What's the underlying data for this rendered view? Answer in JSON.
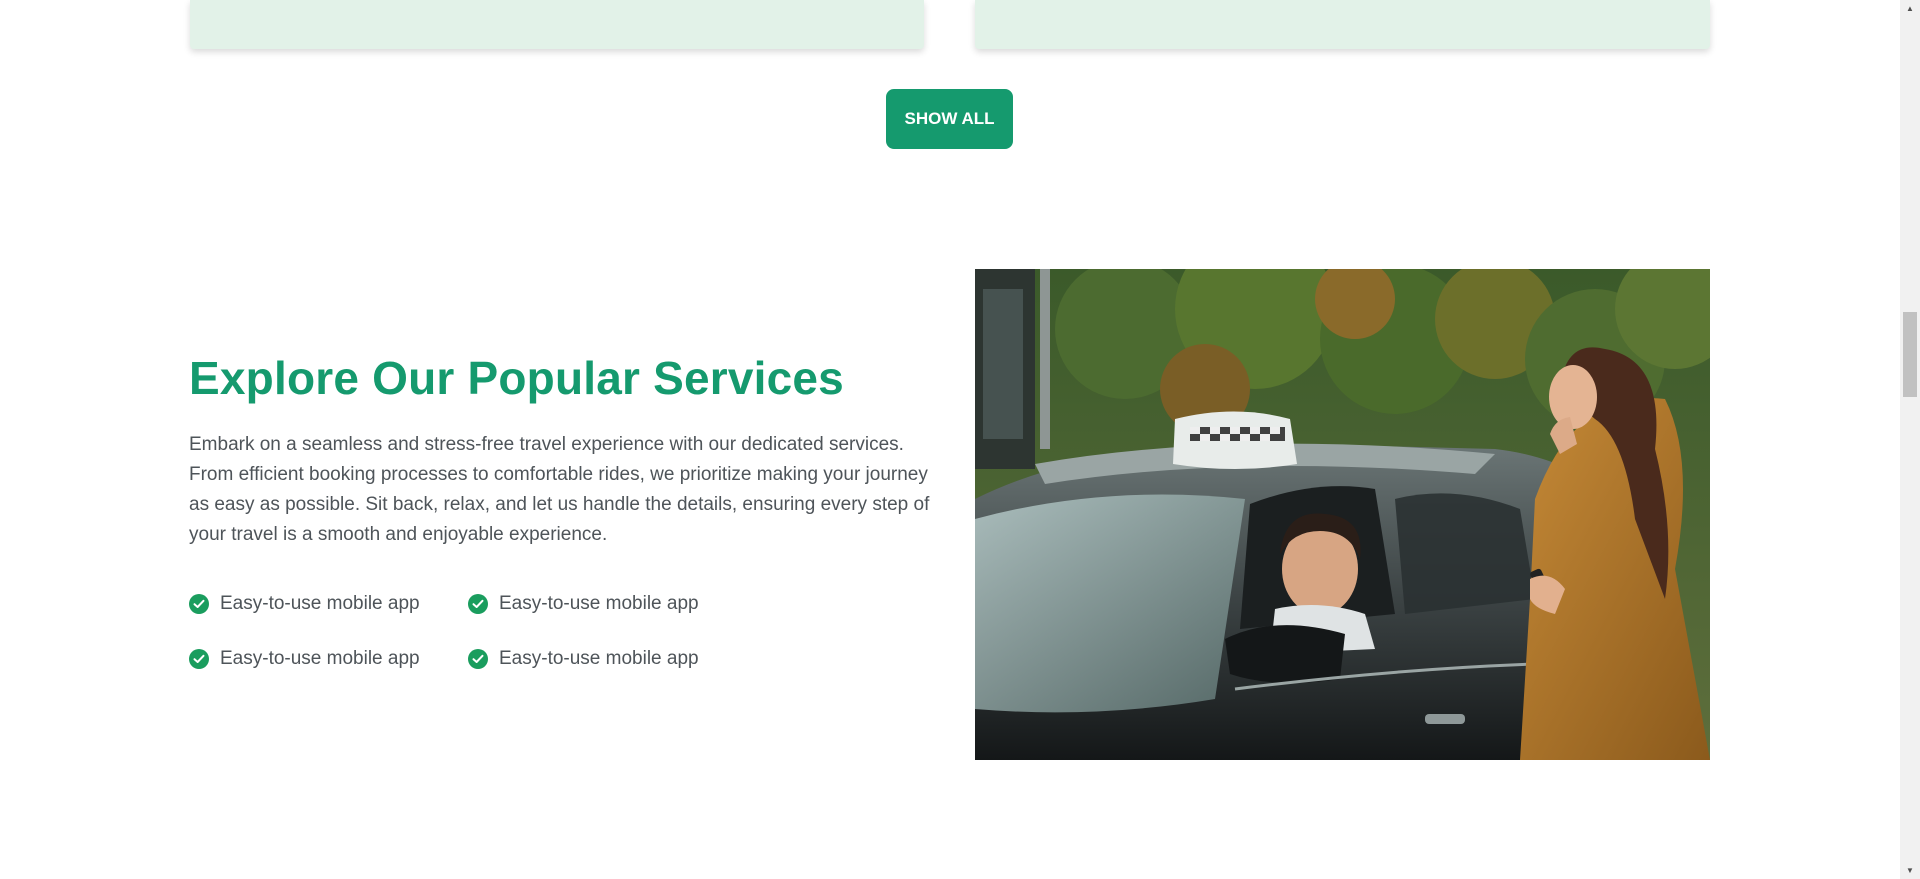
{
  "actions": {
    "show_all_label": "SHOW ALL"
  },
  "services": {
    "title": "Explore Our Popular Services",
    "description": "Embark on a seamless and stress-free travel experience with our dedicated services. From efficient booking processes to comfortable rides, we prioritize making your journey as easy as possible. Sit back, relax, and let us handle the details, ensuring every step of your travel is a smooth and enjoyable experience.",
    "features": [
      "Easy-to-use mobile app",
      "Easy-to-use mobile app",
      "Easy-to-use mobile app",
      "Easy-to-use mobile app"
    ],
    "image_icon": "taxi-photo"
  },
  "colors": {
    "accent": "#159a6e",
    "check": "#1a9d5e",
    "card_bg": "#e2f2e8"
  },
  "scrollbar": {
    "up_icon": "▲",
    "down_icon": "▼"
  }
}
